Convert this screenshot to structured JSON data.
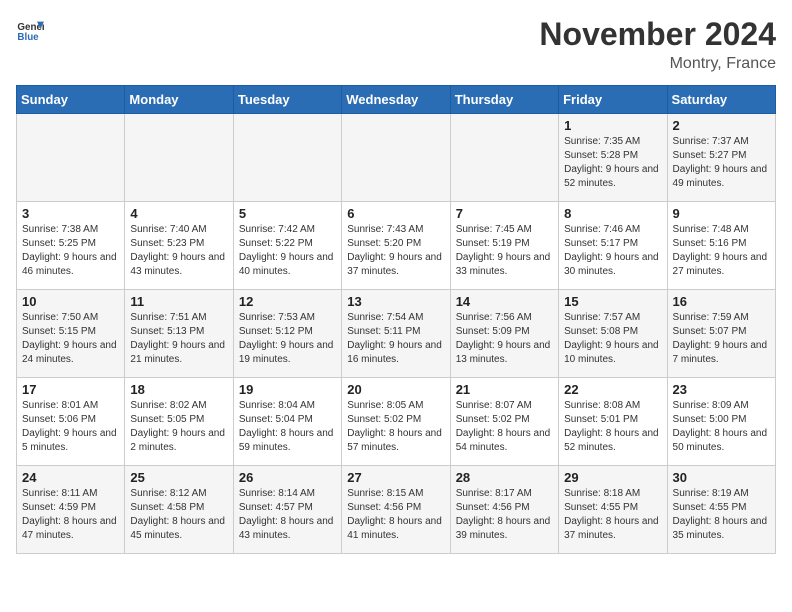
{
  "header": {
    "logo_general": "General",
    "logo_blue": "Blue",
    "month_title": "November 2024",
    "location": "Montry, France"
  },
  "weekdays": [
    "Sunday",
    "Monday",
    "Tuesday",
    "Wednesday",
    "Thursday",
    "Friday",
    "Saturday"
  ],
  "weeks": [
    [
      {
        "day": "",
        "sunrise": "",
        "sunset": "",
        "daylight": ""
      },
      {
        "day": "",
        "sunrise": "",
        "sunset": "",
        "daylight": ""
      },
      {
        "day": "",
        "sunrise": "",
        "sunset": "",
        "daylight": ""
      },
      {
        "day": "",
        "sunrise": "",
        "sunset": "",
        "daylight": ""
      },
      {
        "day": "",
        "sunrise": "",
        "sunset": "",
        "daylight": ""
      },
      {
        "day": "1",
        "sunrise": "Sunrise: 7:35 AM",
        "sunset": "Sunset: 5:28 PM",
        "daylight": "Daylight: 9 hours and 52 minutes."
      },
      {
        "day": "2",
        "sunrise": "Sunrise: 7:37 AM",
        "sunset": "Sunset: 5:27 PM",
        "daylight": "Daylight: 9 hours and 49 minutes."
      }
    ],
    [
      {
        "day": "3",
        "sunrise": "Sunrise: 7:38 AM",
        "sunset": "Sunset: 5:25 PM",
        "daylight": "Daylight: 9 hours and 46 minutes."
      },
      {
        "day": "4",
        "sunrise": "Sunrise: 7:40 AM",
        "sunset": "Sunset: 5:23 PM",
        "daylight": "Daylight: 9 hours and 43 minutes."
      },
      {
        "day": "5",
        "sunrise": "Sunrise: 7:42 AM",
        "sunset": "Sunset: 5:22 PM",
        "daylight": "Daylight: 9 hours and 40 minutes."
      },
      {
        "day": "6",
        "sunrise": "Sunrise: 7:43 AM",
        "sunset": "Sunset: 5:20 PM",
        "daylight": "Daylight: 9 hours and 37 minutes."
      },
      {
        "day": "7",
        "sunrise": "Sunrise: 7:45 AM",
        "sunset": "Sunset: 5:19 PM",
        "daylight": "Daylight: 9 hours and 33 minutes."
      },
      {
        "day": "8",
        "sunrise": "Sunrise: 7:46 AM",
        "sunset": "Sunset: 5:17 PM",
        "daylight": "Daylight: 9 hours and 30 minutes."
      },
      {
        "day": "9",
        "sunrise": "Sunrise: 7:48 AM",
        "sunset": "Sunset: 5:16 PM",
        "daylight": "Daylight: 9 hours and 27 minutes."
      }
    ],
    [
      {
        "day": "10",
        "sunrise": "Sunrise: 7:50 AM",
        "sunset": "Sunset: 5:15 PM",
        "daylight": "Daylight: 9 hours and 24 minutes."
      },
      {
        "day": "11",
        "sunrise": "Sunrise: 7:51 AM",
        "sunset": "Sunset: 5:13 PM",
        "daylight": "Daylight: 9 hours and 21 minutes."
      },
      {
        "day": "12",
        "sunrise": "Sunrise: 7:53 AM",
        "sunset": "Sunset: 5:12 PM",
        "daylight": "Daylight: 9 hours and 19 minutes."
      },
      {
        "day": "13",
        "sunrise": "Sunrise: 7:54 AM",
        "sunset": "Sunset: 5:11 PM",
        "daylight": "Daylight: 9 hours and 16 minutes."
      },
      {
        "day": "14",
        "sunrise": "Sunrise: 7:56 AM",
        "sunset": "Sunset: 5:09 PM",
        "daylight": "Daylight: 9 hours and 13 minutes."
      },
      {
        "day": "15",
        "sunrise": "Sunrise: 7:57 AM",
        "sunset": "Sunset: 5:08 PM",
        "daylight": "Daylight: 9 hours and 10 minutes."
      },
      {
        "day": "16",
        "sunrise": "Sunrise: 7:59 AM",
        "sunset": "Sunset: 5:07 PM",
        "daylight": "Daylight: 9 hours and 7 minutes."
      }
    ],
    [
      {
        "day": "17",
        "sunrise": "Sunrise: 8:01 AM",
        "sunset": "Sunset: 5:06 PM",
        "daylight": "Daylight: 9 hours and 5 minutes."
      },
      {
        "day": "18",
        "sunrise": "Sunrise: 8:02 AM",
        "sunset": "Sunset: 5:05 PM",
        "daylight": "Daylight: 9 hours and 2 minutes."
      },
      {
        "day": "19",
        "sunrise": "Sunrise: 8:04 AM",
        "sunset": "Sunset: 5:04 PM",
        "daylight": "Daylight: 8 hours and 59 minutes."
      },
      {
        "day": "20",
        "sunrise": "Sunrise: 8:05 AM",
        "sunset": "Sunset: 5:02 PM",
        "daylight": "Daylight: 8 hours and 57 minutes."
      },
      {
        "day": "21",
        "sunrise": "Sunrise: 8:07 AM",
        "sunset": "Sunset: 5:02 PM",
        "daylight": "Daylight: 8 hours and 54 minutes."
      },
      {
        "day": "22",
        "sunrise": "Sunrise: 8:08 AM",
        "sunset": "Sunset: 5:01 PM",
        "daylight": "Daylight: 8 hours and 52 minutes."
      },
      {
        "day": "23",
        "sunrise": "Sunrise: 8:09 AM",
        "sunset": "Sunset: 5:00 PM",
        "daylight": "Daylight: 8 hours and 50 minutes."
      }
    ],
    [
      {
        "day": "24",
        "sunrise": "Sunrise: 8:11 AM",
        "sunset": "Sunset: 4:59 PM",
        "daylight": "Daylight: 8 hours and 47 minutes."
      },
      {
        "day": "25",
        "sunrise": "Sunrise: 8:12 AM",
        "sunset": "Sunset: 4:58 PM",
        "daylight": "Daylight: 8 hours and 45 minutes."
      },
      {
        "day": "26",
        "sunrise": "Sunrise: 8:14 AM",
        "sunset": "Sunset: 4:57 PM",
        "daylight": "Daylight: 8 hours and 43 minutes."
      },
      {
        "day": "27",
        "sunrise": "Sunrise: 8:15 AM",
        "sunset": "Sunset: 4:56 PM",
        "daylight": "Daylight: 8 hours and 41 minutes."
      },
      {
        "day": "28",
        "sunrise": "Sunrise: 8:17 AM",
        "sunset": "Sunset: 4:56 PM",
        "daylight": "Daylight: 8 hours and 39 minutes."
      },
      {
        "day": "29",
        "sunrise": "Sunrise: 8:18 AM",
        "sunset": "Sunset: 4:55 PM",
        "daylight": "Daylight: 8 hours and 37 minutes."
      },
      {
        "day": "30",
        "sunrise": "Sunrise: 8:19 AM",
        "sunset": "Sunset: 4:55 PM",
        "daylight": "Daylight: 8 hours and 35 minutes."
      }
    ]
  ]
}
